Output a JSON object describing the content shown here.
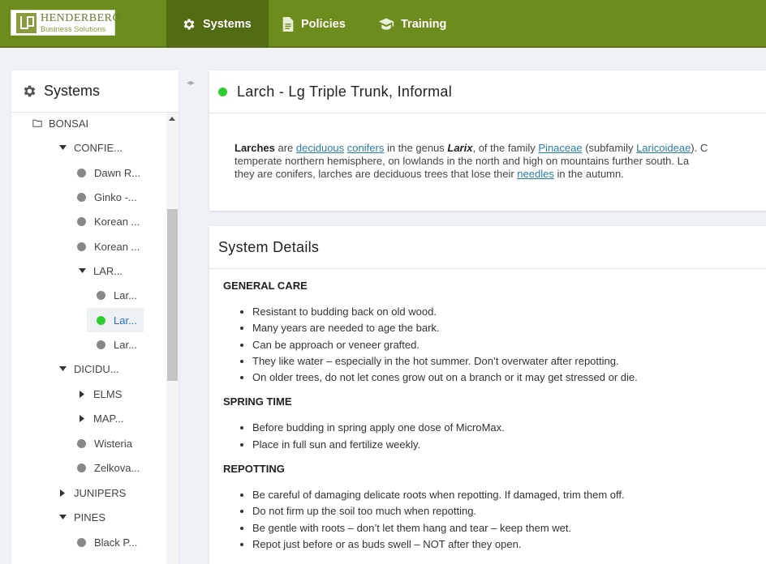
{
  "logo": {
    "name": "HENDERBERG",
    "sub": "Business Solutions"
  },
  "nav": {
    "systems": "Systems",
    "policies": "Policies",
    "training": "Training"
  },
  "sidebar": {
    "title": "Systems",
    "tree": [
      {
        "label": "BONSAI",
        "type": "folder"
      },
      {
        "label": "CONFIE...",
        "type": "expanded"
      },
      {
        "label": "Dawn R...",
        "type": "leaf"
      },
      {
        "label": "Ginko -...",
        "type": "leaf"
      },
      {
        "label": "Korean ...",
        "type": "leaf"
      },
      {
        "label": "Korean ...",
        "type": "leaf"
      },
      {
        "label": "LAR...",
        "type": "expanded"
      },
      {
        "label": "Lar...",
        "type": "leaf"
      },
      {
        "label": "Lar...",
        "type": "leaf",
        "selected": true
      },
      {
        "label": "Lar...",
        "type": "leaf"
      },
      {
        "label": "DICIDU...",
        "type": "expanded"
      },
      {
        "label": "ELMS",
        "type": "collapsed"
      },
      {
        "label": "MAP...",
        "type": "collapsed"
      },
      {
        "label": "Wisteria",
        "type": "leaf"
      },
      {
        "label": "Zelkova...",
        "type": "leaf"
      },
      {
        "label": "JUNIPERS",
        "type": "collapsed"
      },
      {
        "label": "PINES",
        "type": "expanded"
      },
      {
        "label": "Black P...",
        "type": "leaf"
      }
    ]
  },
  "system": {
    "title": "Larch - Lg Triple Trunk, Informal",
    "intro": {
      "larches": "Larches",
      "are": " are ",
      "deciduous": "deciduous",
      "conifers": "conifers",
      "genus": " in the genus ",
      "larix": "Larix",
      "family": ", of the family ",
      "pinaceae": "Pinaceae",
      "subfamily": " (subfamily ",
      "laricoideae": "Laricoideae",
      "end1": "). C",
      "line2": "temperate northern hemisphere, on lowlands in the north and high on mountains further south. La",
      "line3a": "they are conifers, larches are deciduous trees that lose their ",
      "needles": "needles",
      "line3b": " in the autumn."
    }
  },
  "details": {
    "title": "System Details",
    "sections": [
      {
        "heading": "GENERAL CARE",
        "items": [
          "Resistant to budding back on old wood.",
          "Many years are needed to age the bark.",
          "Can be approach or veneer grafted.",
          "They like water – especially in the hot summer.  Don’t overwater after repotting.",
          "On older trees, do not let cones grow out on a branch or it may get stressed or die."
        ]
      },
      {
        "heading": "SPRING TIME",
        "items": [
          "Before budding in spring apply one dose of MicroMax.",
          "Place in full sun and fertilize weekly."
        ]
      },
      {
        "heading": "REPOTTING",
        "items": [
          "Be careful of damaging delicate roots when repotting.  If damaged, trim them off.",
          "Do not firm up the soil too much when repotting.",
          "Be gentle with roots – don’t let them hang and tear – keep them wet.",
          "Repot just before or as buds swell – NOT after they open."
        ]
      }
    ]
  },
  "icons": {
    "systems": "gear-icon",
    "policies": "document-icon",
    "training": "graduation-cap-icon"
  },
  "colors": {
    "topbar": "#6c8c1d",
    "active_tab": "#506b12",
    "status": "#2fcc2f",
    "link": "#2a7fa8"
  }
}
